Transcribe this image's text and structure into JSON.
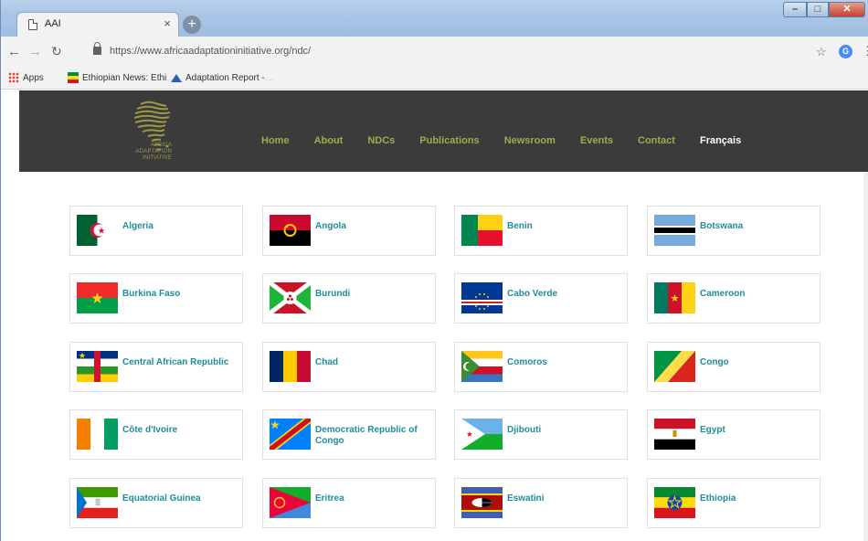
{
  "browser": {
    "tab_title": "AAI",
    "tab_close": "×",
    "new_tab": "+",
    "url": "https://www.africaadaptationinitiative.org/ndc/",
    "bookmarks": [
      {
        "label": "Apps",
        "icon": "apps-grid-icon"
      },
      {
        "label": "Ethiopian News: Ethi",
        "icon": "ethiopia-flag-icon"
      },
      {
        "label": "Adaptation Report -",
        "icon": "adaptation-icon"
      }
    ],
    "profile_initial": "G"
  },
  "site": {
    "logo_text": [
      "AFRICA",
      "ADAPTATION",
      "INITIATIVE"
    ],
    "nav": [
      "Home",
      "About",
      "NDCs",
      "Publications",
      "Newsroom",
      "Events",
      "Contact",
      "Français"
    ]
  },
  "countries": [
    {
      "name": "Algeria",
      "flag": "algeria"
    },
    {
      "name": "Angola",
      "flag": "angola"
    },
    {
      "name": "Benin",
      "flag": "benin"
    },
    {
      "name": "Botswana",
      "flag": "botswana"
    },
    {
      "name": "Burkina Faso",
      "flag": "burkina-faso"
    },
    {
      "name": "Burundi",
      "flag": "burundi"
    },
    {
      "name": "Cabo Verde",
      "flag": "cabo-verde"
    },
    {
      "name": "Cameroon",
      "flag": "cameroon"
    },
    {
      "name": "Central African Republic",
      "flag": "central-african-republic"
    },
    {
      "name": "Chad",
      "flag": "chad"
    },
    {
      "name": "Comoros",
      "flag": "comoros"
    },
    {
      "name": "Congo",
      "flag": "congo"
    },
    {
      "name": "Côte d'Ivoire",
      "flag": "cote-divoire"
    },
    {
      "name": "Democratic Republic of Congo",
      "flag": "dr-congo"
    },
    {
      "name": "Djibouti",
      "flag": "djibouti"
    },
    {
      "name": "Egypt",
      "flag": "egypt"
    },
    {
      "name": "Equatorial Guinea",
      "flag": "equatorial-guinea"
    },
    {
      "name": "Eritrea",
      "flag": "eritrea"
    },
    {
      "name": "Eswatini",
      "flag": "eswatini"
    },
    {
      "name": "Ethiopia",
      "flag": "ethiopia"
    }
  ],
  "colors": {
    "header_bg": "#3b3b3b",
    "nav_link": "#9eab4f",
    "nav_active": "#ffffff",
    "country_link": "#1f8d9a"
  }
}
